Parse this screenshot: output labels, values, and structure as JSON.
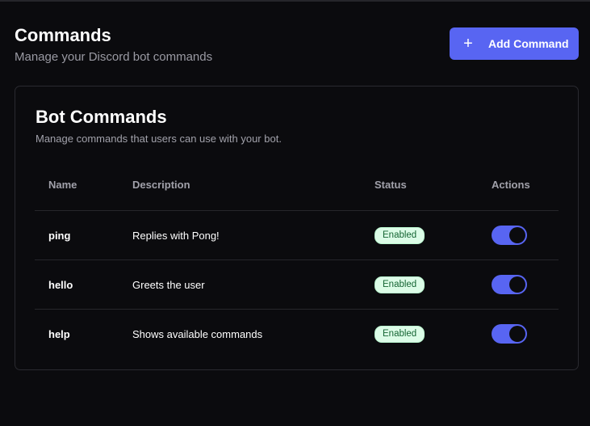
{
  "header": {
    "title": "Commands",
    "subtitle": "Manage your Discord bot commands",
    "add_button_label": "Add Command",
    "add_button_icon": "plus-icon"
  },
  "card": {
    "title": "Bot Commands",
    "description": "Manage commands that users can use with your bot.",
    "columns": {
      "name": "Name",
      "description": "Description",
      "status": "Status",
      "actions": "Actions"
    },
    "rows": [
      {
        "name": "ping",
        "description": "Replies with Pong!",
        "status": "Enabled",
        "enabled": true
      },
      {
        "name": "hello",
        "description": "Greets the user",
        "status": "Enabled",
        "enabled": true
      },
      {
        "name": "help",
        "description": "Shows available commands",
        "status": "Enabled",
        "enabled": true
      }
    ]
  },
  "colors": {
    "accent": "#5865f2",
    "background": "#0b0b0e",
    "badge_bg": "#dcfce7",
    "badge_text": "#166534"
  }
}
